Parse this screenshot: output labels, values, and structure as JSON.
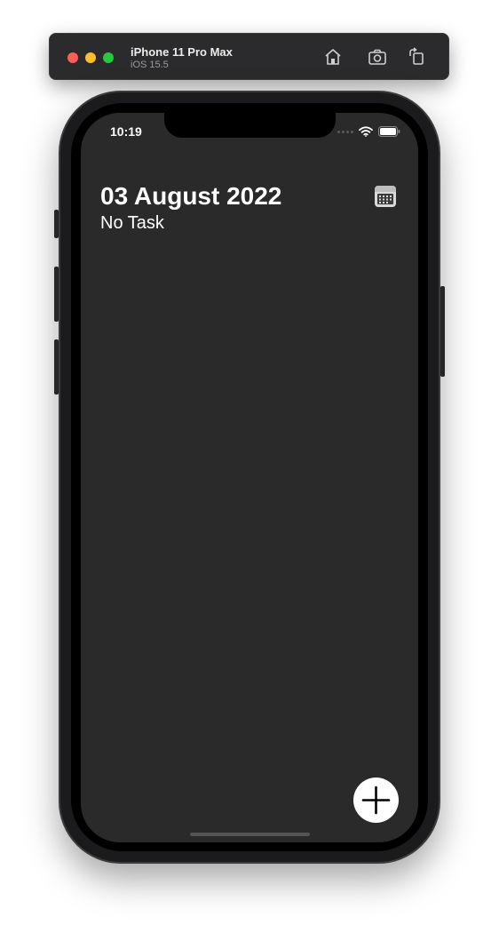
{
  "simulator": {
    "device_name": "iPhone 11 Pro Max",
    "os_version": "iOS 15.5",
    "buttons": [
      "home-icon",
      "screenshot-icon",
      "rotate-icon"
    ]
  },
  "status_bar": {
    "time": "10:19"
  },
  "main": {
    "date_title": "03 August 2022",
    "task_status": "No Task"
  },
  "colors": {
    "screen_background": "#2a2a2a",
    "text": "#ffffff",
    "fab_background": "#ffffff",
    "fab_icon": "#000000"
  }
}
